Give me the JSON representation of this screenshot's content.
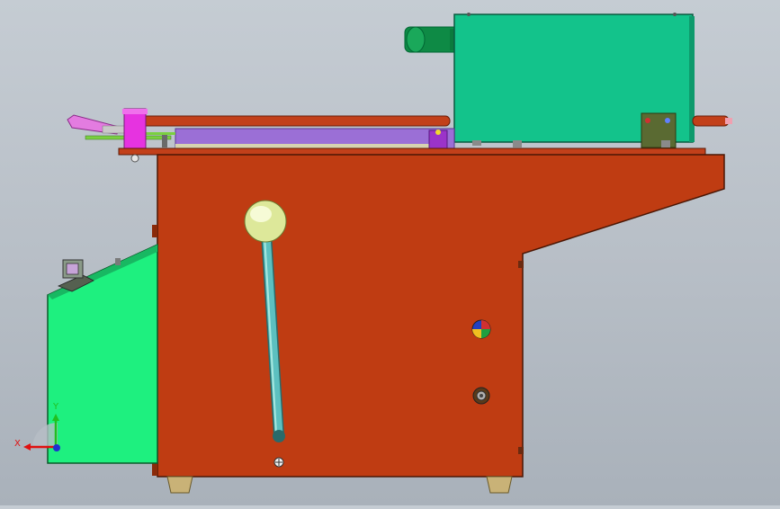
{
  "viewport": {
    "background_top": "#c5ccd3",
    "background_bottom": "#a9b1ba"
  },
  "model_colors": {
    "frame": "#bf3c12",
    "motor_box": "#13c38b",
    "control_box": "#1ef07f",
    "roller_bar": "#c2401a",
    "clamp": "#e633e0",
    "plate": "#9b6fd6",
    "lever_rod": "#4fb3b0",
    "lever_knob": "#e6f0a8",
    "feet": "#c9b277"
  },
  "triad": {
    "x_label": "X",
    "y_label": "Y",
    "x_color": "#e01010",
    "y_color": "#20c020",
    "z_color": "#2030d0"
  },
  "icons": {
    "color_wheel": "color-wheel-icon",
    "socket": "socket-icon",
    "screw": "screw-icon"
  }
}
